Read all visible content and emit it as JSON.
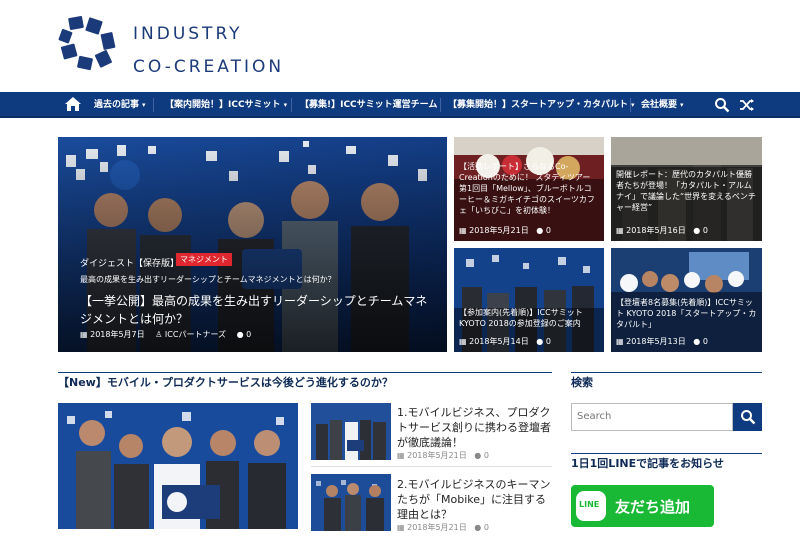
{
  "brand": {
    "line1": "INDUSTRY",
    "line2": "CO-CREATION"
  },
  "nav": {
    "items": [
      {
        "label": "過去の記事",
        "has_menu": true
      },
      {
        "label": "【案内開始！】ICCサミット",
        "has_menu": true
      },
      {
        "label": "【募集!】ICCサミット運営チーム",
        "has_menu": false
      },
      {
        "label": "【募集開始！】スタートアップ・カタパルト",
        "has_menu": true
      },
      {
        "label": "会社概要",
        "has_menu": true
      }
    ],
    "chevron": "▾",
    "icons": [
      "home-icon",
      "search-icon",
      "shuffle-icon"
    ]
  },
  "hero": {
    "category": "ダイジェスト【保存版】",
    "badge": "マネジメント",
    "excerpt": "最高の成果を生み出すリーダーシップとチームマネジメントとは何か？",
    "title": "【一挙公開】最高の成果を生み出すリーダーシップとチームマネジメントとは何か？",
    "date": "2018年5月7日",
    "author": "ICCパートナーズ",
    "comments": "0"
  },
  "grid_posts": [
    {
      "title": "【活動レポート】さらなるCo-Creationのために！ スタディツアー第1回目「Mellow」、ブルーボトルコーヒー＆ミガキイチゴのスイーツカフェ「いちびこ」を初体験！",
      "date": "2018年5月21日",
      "comments": "0"
    },
    {
      "title": "開催レポート：歴代のカタパルト優勝者たちが登場！「カタパルト・アルムナイ」で議論した“世界を変えるベンチャー経営”",
      "date": "2018年5月16日",
      "comments": "0"
    },
    {
      "title": "【参加案内(先着順)】ICCサミット KYOTO 2018の参加登録のご案内",
      "date": "2018年5月14日",
      "comments": "0"
    },
    {
      "title": "【登壇者8名募集(先着順)】ICCサミット KYOTO 2018「スタートアップ・カタパルト」",
      "date": "2018年5月13日",
      "comments": "0"
    }
  ],
  "feature_section": {
    "title": "【New】モバイル・プロダクトサービスは今後どう進化するのか？",
    "posts": [
      {
        "title": "1.モバイルビジネス、プロダクトサービス創りに携わる登壇者が徹底議論！",
        "date": "2018年5月21日",
        "comments": "0"
      },
      {
        "title": "2.モバイルビジネスのキーマンたちが「Mobike」に注目する理由とは？",
        "date": "2018年5月21日",
        "comments": "0"
      }
    ]
  },
  "sidebar": {
    "search_title": "検索",
    "search_placeholder": "Search",
    "line_title": "1日1回LINEで記事をお知らせ",
    "line_button": "友だち追加",
    "line_logo": "LINE"
  },
  "colors": {
    "navy": "#0e3a7f",
    "accent_red": "#e0262e",
    "line_green": "#19b935"
  }
}
